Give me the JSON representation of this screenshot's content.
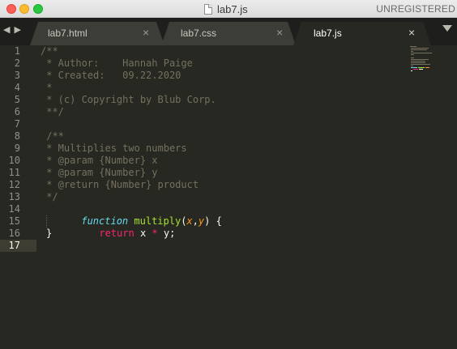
{
  "window": {
    "title": "lab7.js",
    "status": "UNREGISTERED"
  },
  "icons": {
    "traffic_close": "close-window-icon",
    "traffic_minimize": "minimize-window-icon",
    "traffic_maximize": "maximize-window-icon",
    "file": "document-icon",
    "nav_left": "◀",
    "nav_right": "▶",
    "tab_close": "×",
    "overflow": "chevron-down-icon"
  },
  "tabs": [
    {
      "label": "lab7.html",
      "active": false
    },
    {
      "label": "lab7.css",
      "active": false
    },
    {
      "label": "lab7.js",
      "active": true
    }
  ],
  "editor": {
    "current_line": 17,
    "line_numbers": [
      "1",
      "2",
      "3",
      "4",
      "5",
      "6",
      "7",
      "8",
      "9",
      "10",
      "11",
      "12",
      "13",
      "14",
      "15",
      "16",
      "17"
    ],
    "lines": {
      "l1": "/**",
      "l2": " * Author:    Hannah Paige",
      "l3": " * Created:   09.22.2020",
      "l4": " *",
      "l5": " * (c) Copyright by Blub Corp.",
      "l6": " **/",
      "l7": "",
      "l8": " /**",
      "l9": " * Multiplies two numbers",
      "l10": " * @param {Number} x",
      "l11": " * @param {Number} y",
      "l12": " * @return {Number} product",
      "l13": " */",
      "l14_kw": "function",
      "l14_name": "multiply",
      "l14_open": "(",
      "l14_p1": "x",
      "l14_comma": ",",
      "l14_p2": "y",
      "l14_close": ") {",
      "l15_kw": "return",
      "l15_a": "x",
      "l15_op": "*",
      "l15_b": "y;",
      "l16": "}",
      "l17": ""
    }
  },
  "colors": {
    "background": "#272822",
    "comment": "#75715e",
    "keyword": "#f92672",
    "storage": "#66d9ef",
    "function": "#a6e22e",
    "parameter": "#fd971f",
    "text": "#f8f8f2"
  }
}
